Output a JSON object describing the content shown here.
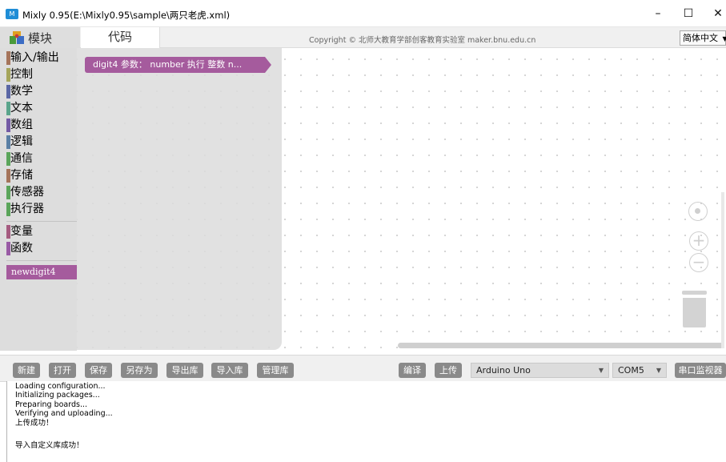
{
  "window": {
    "title": "Mixly 0.95(E:\\Mixly0.95\\sample\\两只老虎.xml)",
    "app_icon_text": "M",
    "minimize": "–",
    "maximize": "☐",
    "close": "✕"
  },
  "header": {
    "tab_blocks": "模块",
    "tab_code": "代码",
    "copyright": "Copyright © 北师大教育学部创客教育实验室 maker.bnu.edu.cn",
    "language": "简体中文"
  },
  "toolbox": {
    "categories": [
      {
        "label": "输入/输出",
        "color": "#a5745b"
      },
      {
        "label": "控制",
        "color": "#a5a55b"
      },
      {
        "label": "数学",
        "color": "#5b67a5"
      },
      {
        "label": "文本",
        "color": "#5ba58c"
      },
      {
        "label": "数组",
        "color": "#745ba5"
      },
      {
        "label": "逻辑",
        "color": "#5b80a5"
      },
      {
        "label": "通信",
        "color": "#5ba55b"
      },
      {
        "label": "存储",
        "color": "#a5745b"
      },
      {
        "label": "传感器",
        "color": "#5ba55b"
      },
      {
        "label": "执行器",
        "color": "#5ba55b"
      },
      {
        "label": "变量",
        "color": "#a55b80"
      },
      {
        "label": "函数",
        "color": "#995ba5"
      }
    ],
    "custom": "newdigit4"
  },
  "workspace": {
    "block_text": "digit4 参数： number 执行 整数  n..."
  },
  "buttons": {
    "new": "新建",
    "open": "打开",
    "save": "保存",
    "save_as": "另存为",
    "export_lib": "导出库",
    "import_lib": "导入库",
    "manage_lib": "管理库",
    "compile": "编译",
    "upload": "上传",
    "board": "Arduino Uno",
    "port": "COM5",
    "serial_monitor": "串口监视器"
  },
  "console": {
    "lines": [
      "Loading configuration...",
      "Initializing packages...",
      "Preparing boards...",
      "Verifying and uploading...",
      "上传成功！",
      "",
      "导入自定义库成功！"
    ]
  }
}
